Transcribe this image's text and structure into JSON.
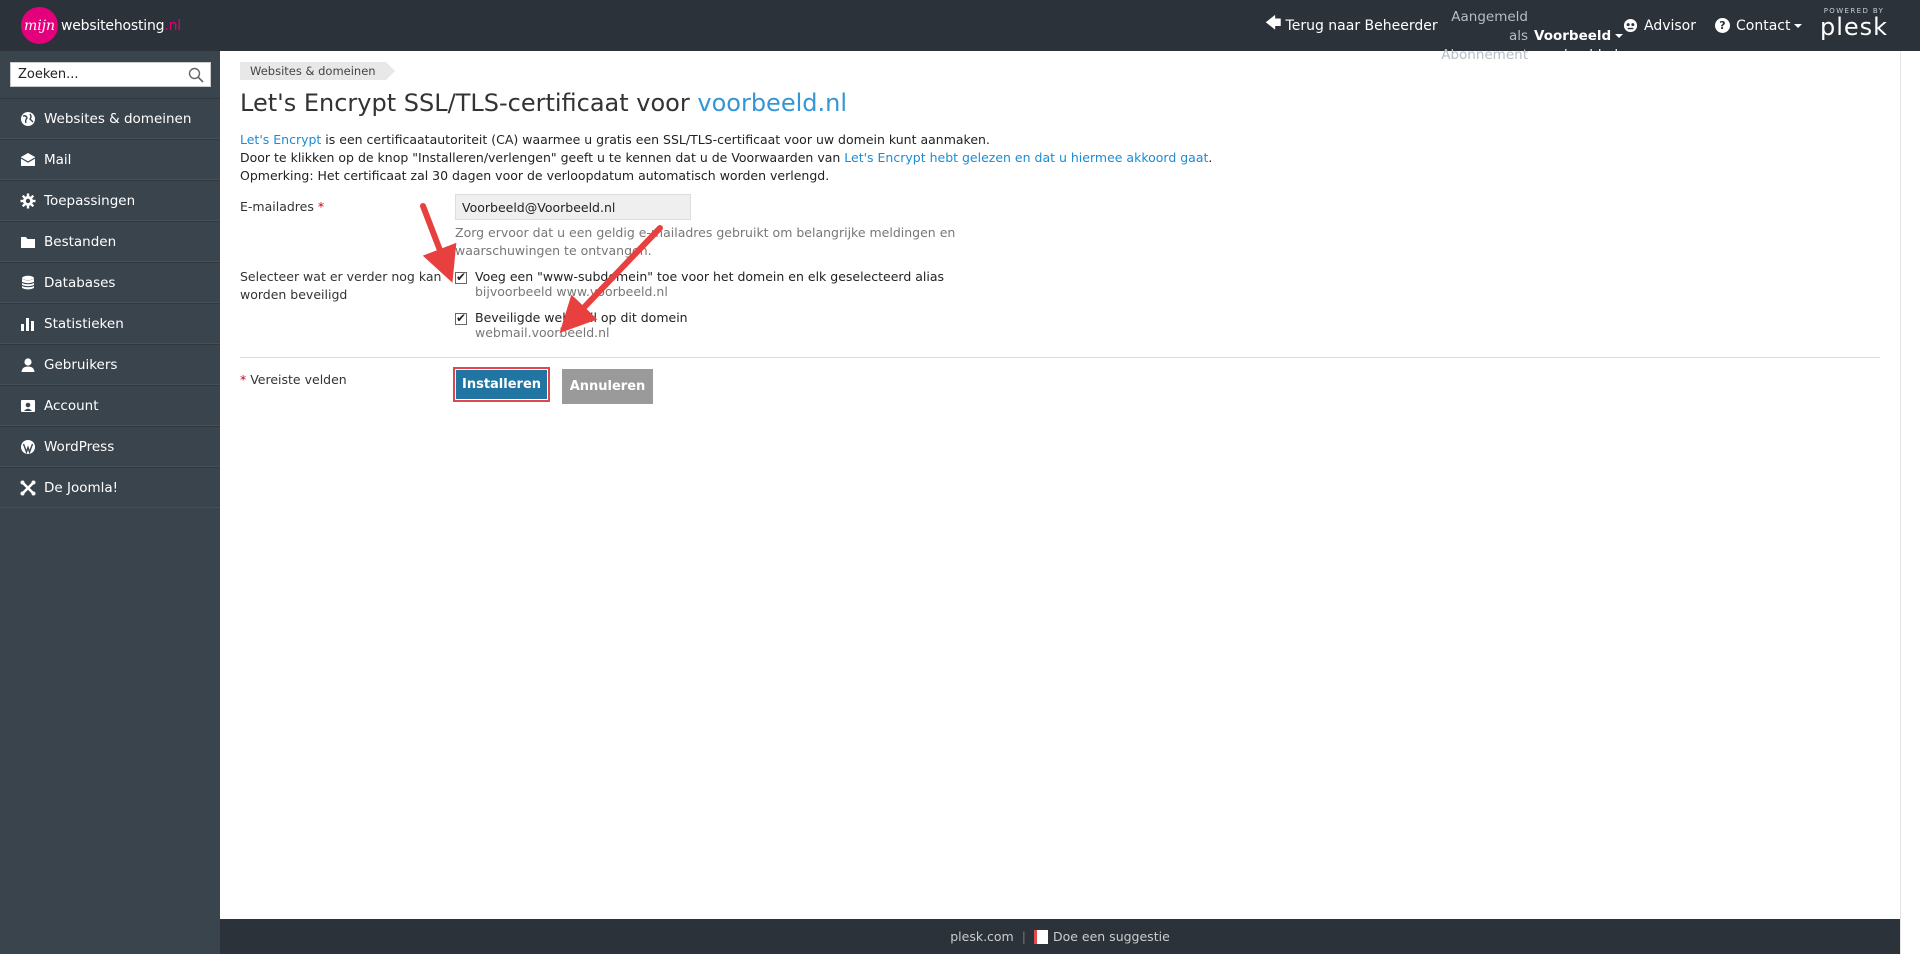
{
  "topbar": {
    "logo_mark": "mijn",
    "logo_name": "websitehosting",
    "logo_tld": ".nl",
    "back_label": "Terug naar Beheerder",
    "logged_in_label": "Aangemeld als",
    "logged_in_user": "Voorbeeld",
    "subscription_label": "Abonnement",
    "subscription_value": "voorbeeld.nl",
    "advisor_label": "Advisor",
    "contact_label": "Contact",
    "powered_by": "POWERED BY",
    "plesk_brand": "plesk"
  },
  "sidebar": {
    "search_placeholder": "Zoeken...",
    "items": [
      {
        "label": "Websites & domeinen",
        "icon": "globe-icon"
      },
      {
        "label": "Mail",
        "icon": "envelope-icon"
      },
      {
        "label": "Toepassingen",
        "icon": "gear-icon"
      },
      {
        "label": "Bestanden",
        "icon": "folder-icon"
      },
      {
        "label": "Databases",
        "icon": "database-icon"
      },
      {
        "label": "Statistieken",
        "icon": "bar-chart-icon"
      },
      {
        "label": "Gebruikers",
        "icon": "user-icon"
      },
      {
        "label": "Account",
        "icon": "id-card-icon"
      },
      {
        "label": "WordPress",
        "icon": "wordpress-icon"
      },
      {
        "label": "De Joomla!",
        "icon": "joomla-icon"
      }
    ]
  },
  "main": {
    "breadcrumb": "Websites & domeinen",
    "title_prefix": "Let's Encrypt SSL/TLS-certificaat voor",
    "title_domain": "voorbeeld.nl",
    "intro": {
      "line1_link": "Let's Encrypt",
      "line1_text": " is een certificaatautoriteit (CA) waarmee u gratis een SSL/TLS-certificaat voor uw domein kunt aanmaken.",
      "line2_text": "Door te klikken op de knop \"Installeren/verlengen\" geeft u te kennen dat u de Voorwaarden van ",
      "line2_link": "Let's Encrypt hebt gelezen en dat u hiermee akkoord gaat",
      "line2_end": ".",
      "line3_text": "Opmerking: Het certificaat zal 30 dagen voor de verloopdatum automatisch worden verlengd."
    },
    "email": {
      "label": "E-mailadres",
      "required_mark": "*",
      "value": "Voorbeeld@Voorbeeld.nl",
      "hint_line1": "Zorg ervoor dat u een geldig e-mailadres gebruikt om belangrijke meldingen en",
      "hint_line2": "waarschuwingen te ontvangen."
    },
    "secure_more": {
      "label_line1": "Selecteer wat er verder nog kan",
      "label_line2": "worden beveiligd",
      "options": [
        {
          "label": "Voeg een \"www-subdomein\" toe voor het domein en elk geselecteerd alias",
          "hint": "bijvoorbeeld www.voorbeeld.nl",
          "checked": true
        },
        {
          "label": "Beveiligde webmail op dit domein",
          "hint": "webmail.voorbeeld.nl",
          "checked": true
        }
      ]
    },
    "required_note_mark": "*",
    "required_note": " Vereiste velden",
    "install_button": "Installeren",
    "cancel_button": "Annuleren",
    "annotation_arrow_color": "#e8403f"
  },
  "footer": {
    "plesk_link": "plesk.com",
    "separator": "|",
    "suggest_link": "Doe een suggestie"
  }
}
